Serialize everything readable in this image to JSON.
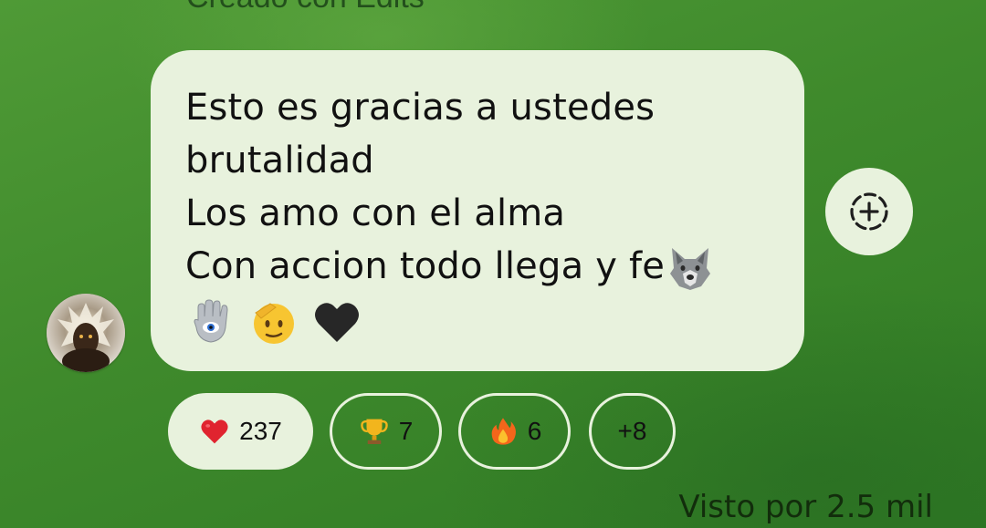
{
  "previous_message": {
    "caption": "Creado con Edits"
  },
  "message": {
    "lines": [
      "Esto es gracias a ustedes",
      "brutalidad",
      "Los amo con el alma",
      "Con accion todo llega y fe"
    ],
    "emojis": [
      "wolf-face",
      "hamsa-hand",
      "saluting-face",
      "black-heart"
    ]
  },
  "add_reaction": {
    "icon": "dashed-circle-plus-icon"
  },
  "reactions": [
    {
      "emoji": "red-heart",
      "count": "237",
      "selected": true
    },
    {
      "emoji": "trophy",
      "count": "7",
      "selected": false
    },
    {
      "emoji": "fire",
      "count": "6",
      "selected": false
    },
    {
      "emoji": "",
      "count": "+8",
      "selected": false
    }
  ],
  "footer": {
    "seen_label": "Visto por 2.5 mil"
  },
  "colors": {
    "bubble": "#e8f2dd",
    "background": "#3f8a2c",
    "text": "#111111"
  }
}
